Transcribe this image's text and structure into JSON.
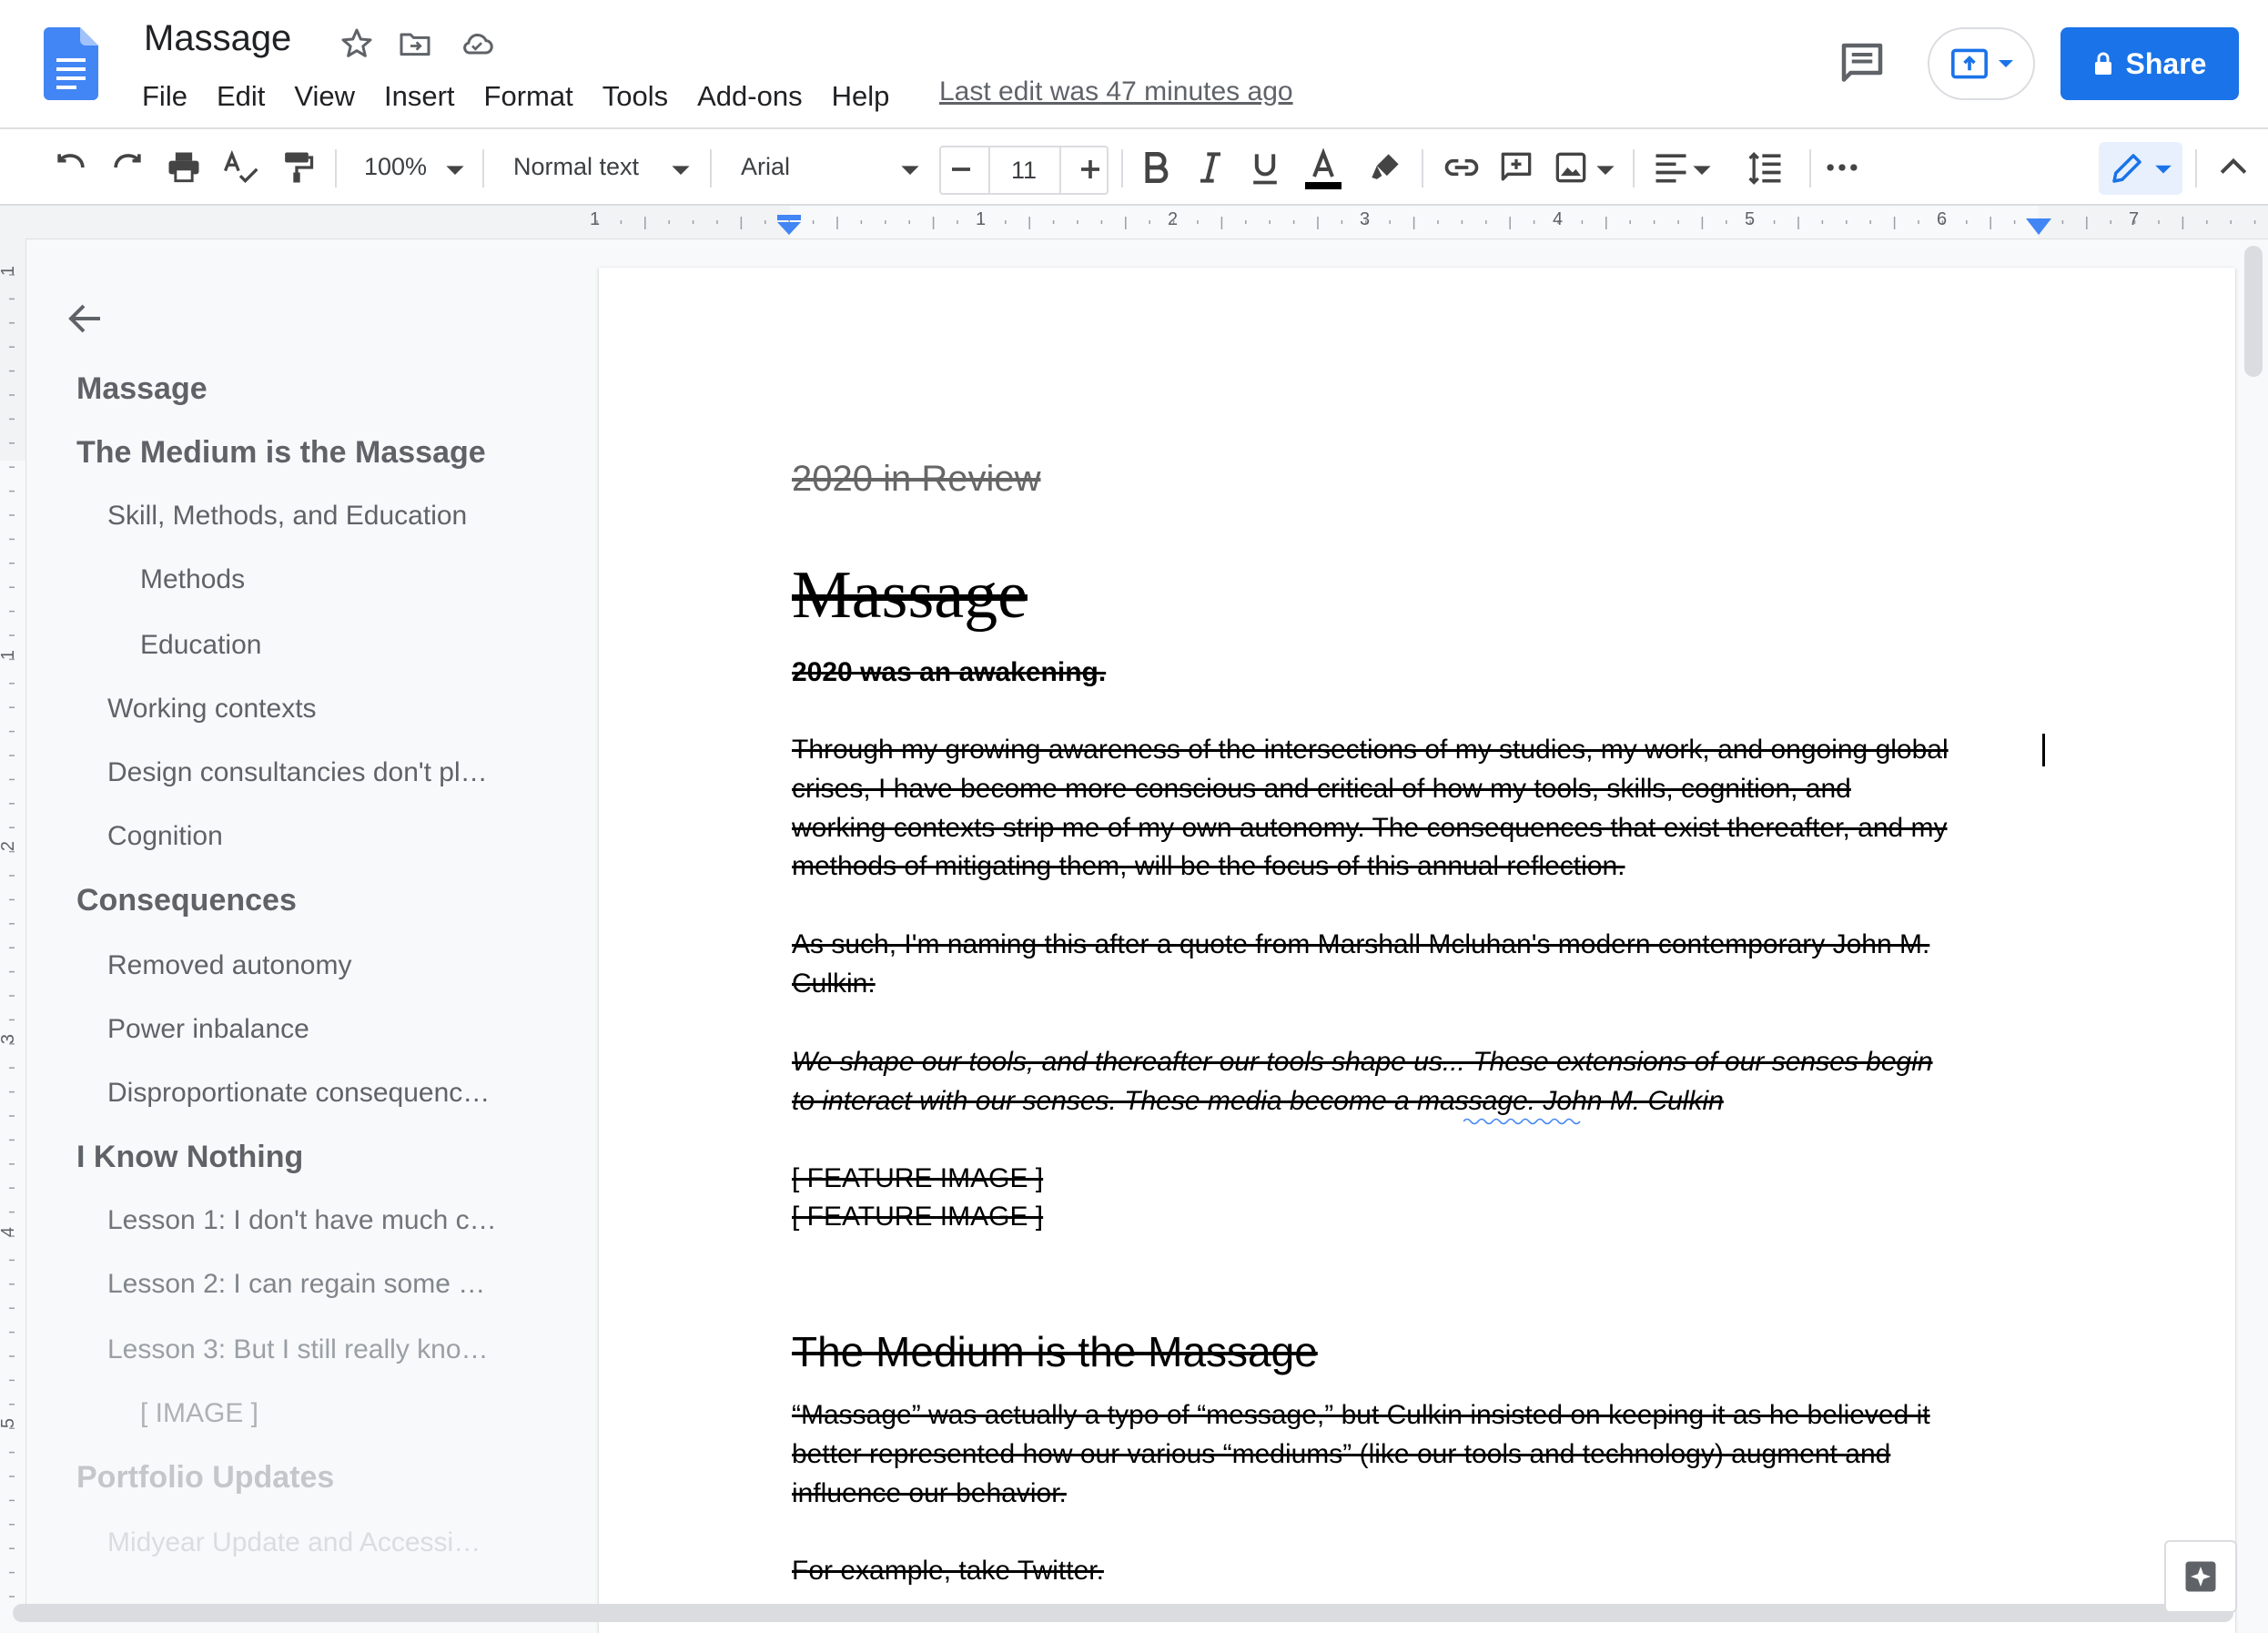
{
  "app": {
    "doc_title": "Massage",
    "last_edit": "Last edit was 47 minutes ago",
    "share_label": "Share"
  },
  "menu": [
    "File",
    "Edit",
    "View",
    "Insert",
    "Format",
    "Tools",
    "Add-ons",
    "Help"
  ],
  "toolbar": {
    "zoom": "100%",
    "style": "Normal text",
    "font": "Arial",
    "font_size": "11",
    "icons": [
      "undo-icon",
      "redo-icon",
      "print-icon",
      "spellcheck-icon",
      "paint-format-icon",
      "bold-icon",
      "italic-icon",
      "underline-icon",
      "text-color-icon",
      "highlight-icon",
      "link-icon",
      "comment-icon",
      "image-icon",
      "align-icon",
      "line-spacing-icon",
      "more-icon",
      "edit-mode-icon",
      "collapse-icon"
    ]
  },
  "ruler": {
    "top_numbers": [
      "1",
      "1",
      "2",
      "3",
      "4",
      "5",
      "6",
      "7"
    ],
    "left_numbers": [
      "1",
      "1",
      "2",
      "3",
      "4",
      "5"
    ]
  },
  "outline": {
    "items": [
      {
        "text": "Massage",
        "level": 1
      },
      {
        "text": "The Medium is the Massage",
        "level": 1
      },
      {
        "text": "Skill, Methods, and Education",
        "level": 2
      },
      {
        "text": "Methods",
        "level": 3
      },
      {
        "text": "Education",
        "level": 3
      },
      {
        "text": "Working contexts",
        "level": 2
      },
      {
        "text": "Design consultancies don't pl…",
        "level": 2
      },
      {
        "text": "Cognition",
        "level": 2
      },
      {
        "text": "Consequences",
        "level": 1
      },
      {
        "text": "Removed autonomy",
        "level": 2
      },
      {
        "text": "Power inbalance",
        "level": 2
      },
      {
        "text": "Disproportionate consequenc…",
        "level": 2
      },
      {
        "text": "I Know Nothing",
        "level": 1
      },
      {
        "text": "Lesson 1: I don't have much c…",
        "level": 2
      },
      {
        "text": "Lesson 2: I can regain some …",
        "level": 2
      },
      {
        "text": "Lesson 3: But I still really kno…",
        "level": 2
      },
      {
        "text": "[ IMAGE ]",
        "level": 3
      },
      {
        "text": "Portfolio Updates",
        "level": 1
      },
      {
        "text": "Midyear Update and Accessi…",
        "level": 2
      }
    ]
  },
  "document": {
    "subtitle": "2020 in Review",
    "title": "Massage",
    "lead": "2020 was an awakening.",
    "para1": [
      "Through my growing awareness of the intersections of my studies, my work, and ongoing global",
      "crises, I have become more conscious and critical of how my tools, skills, cognition, and",
      "working contexts strip me of my own autonomy. The consequences that exist thereafter, and my",
      "methods of mitigating them, will be the focus of this annual reflection."
    ],
    "para2": [
      "As such, I'm naming this after a quote from Marshall Mcluhan's modern contemporary John M.",
      "Culkin:"
    ],
    "quote": [
      "We shape our tools, and thereafter our tools shape us... These extensions of our senses begin",
      "to interact with our senses. These media become a massage. John M. Culkin"
    ],
    "feature1": "[ FEATURE IMAGE ]",
    "feature2": "[ FEATURE IMAGE ]",
    "heading2": "The Medium is the Massage",
    "para3": [
      "“Massage” was actually a typo of “message,” but Culkin insisted on keeping it as he believed it",
      "better represented how our various “mediums” (like our tools and technology) augment and",
      "influence our behavior."
    ],
    "para4": "For example, take Twitter."
  },
  "colors": {
    "accent": "#1a73e8",
    "doc_icon": "#4285f4",
    "outline_text": "#5f6368"
  }
}
